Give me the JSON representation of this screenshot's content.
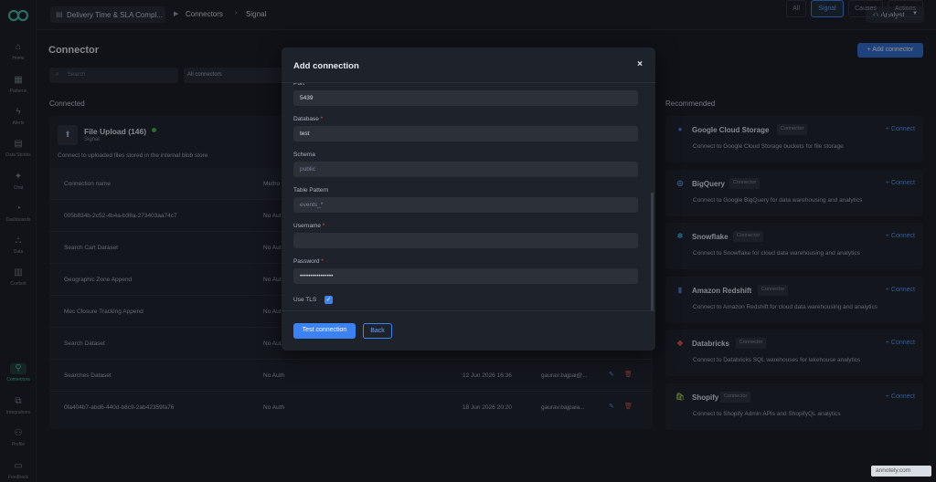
{
  "topbar": {
    "project": "Delivery Time & SLA Compl...",
    "crumb_1": "Connectors",
    "crumb_2": "Signal",
    "user": "Analyst"
  },
  "sidebar": {
    "items": [
      {
        "label": "Home",
        "icon": "home-icon"
      },
      {
        "label": "Patterns",
        "icon": "patterns-icon"
      },
      {
        "label": "Alerts",
        "icon": "alerts-icon"
      },
      {
        "label": "Data Stories",
        "icon": "data-stories-icon"
      },
      {
        "label": "Chat",
        "icon": "chat-icon"
      },
      {
        "label": "Dashboards",
        "icon": "dashboards-icon"
      },
      {
        "label": "Data",
        "icon": "data-icon"
      },
      {
        "label": "Context",
        "icon": "context-icon"
      },
      {
        "label": "Connectors",
        "icon": "connectors-icon"
      },
      {
        "label": "Integrations",
        "icon": "integrations-icon"
      },
      {
        "label": "Profile",
        "icon": "profile-icon"
      },
      {
        "label": "Feedback",
        "icon": "feedback-icon"
      }
    ]
  },
  "main": {
    "title": "Connector",
    "add_connector": "+ Add connector",
    "search_placeholder": "Search",
    "filter": "All connectors",
    "tabs": [
      "All",
      "Signal",
      "Causes",
      "Actions"
    ],
    "connected_label": "Connected",
    "recommended_label": "Recommended"
  },
  "connected": {
    "name": "File Upload",
    "count": "(146)",
    "type": "Signal",
    "description": "Connect to uploaded files stored in the internal blob store",
    "columns": [
      "Connection name",
      "Metho"
    ],
    "rows": [
      {
        "name": "005b834b-2c52-4b4a-b38a-273403aa74c7",
        "method": "No Aut",
        "date": "",
        "user": ""
      },
      {
        "name": "Search Cart Dataset",
        "method": "No Aut",
        "date": "",
        "user": ""
      },
      {
        "name": "Geographic Zone Append",
        "method": "No Aut",
        "date": "",
        "user": ""
      },
      {
        "name": "Mec Closure Tracking Append",
        "method": "No Aut",
        "date": "",
        "user": ""
      },
      {
        "name": "Search Dataset",
        "method": "No Aut",
        "date": "",
        "user": ""
      },
      {
        "name": "Searches Dataset",
        "method": "No Auth",
        "date": "12 Jun 2026 16:36",
        "user": "gaurav.bajpai@..."
      },
      {
        "name": "0fa404b7-abd6-440d-b8c9-2ab42359fa76",
        "method": "No Auth",
        "date": "18 Jun 2026 20:20",
        "user": "gaurav.bajpaia..."
      }
    ]
  },
  "recommended": [
    {
      "name": "Google Cloud Storage",
      "badge": "Connector",
      "connect": "+ Connect",
      "description": "Connect to Google Cloud Storage buckets for file storage",
      "color": "#4285f4"
    },
    {
      "name": "BigQuery",
      "badge": "Connector",
      "connect": "+ Connect",
      "description": "Connect to Google BigQuery for data warehousing and analytics",
      "color": "#669df6"
    },
    {
      "name": "Snowflake",
      "badge": "Connector",
      "connect": "+ Connect",
      "description": "Connect to Snowflake for cloud data warehousing and analytics",
      "color": "#29b5e8"
    },
    {
      "name": "Amazon Redshift",
      "badge": "Connector",
      "connect": "+ Connect",
      "description": "Connect to Amazon Redshift for cloud data warehousing and analytics",
      "color": "#4a7cd8"
    },
    {
      "name": "Databricks",
      "badge": "Connector",
      "connect": "+ Connect",
      "description": "Connect to Databricks SQL warehouses for lakehouse analytics",
      "color": "#e5534b"
    },
    {
      "name": "Shopify",
      "badge": "Connector",
      "connect": "+ Connect",
      "description": "Connect to Shopify Admin APIs and ShopifyQL analytics",
      "color": "#95bf47"
    }
  ],
  "modal": {
    "title": "Add connection",
    "close": "×",
    "fields": [
      {
        "label": "Port",
        "required": false,
        "value": "5439",
        "placeholder": false
      },
      {
        "label": "Database",
        "required": true,
        "value": "test",
        "placeholder": false
      },
      {
        "label": "Schema",
        "required": false,
        "value": "public",
        "placeholder": true
      },
      {
        "label": "Table Pattern",
        "required": false,
        "value": "events_*",
        "placeholder": true
      },
      {
        "label": "Username",
        "required": true,
        "value": "",
        "placeholder": false
      },
      {
        "label": "Password",
        "required": true,
        "value": "••••••••••••••••",
        "placeholder": false
      }
    ],
    "use_tls_label": "Use TLS",
    "use_tls_checked": true,
    "test_button": "Test connection",
    "back_button": "Back"
  },
  "watermark": "annotely.com"
}
